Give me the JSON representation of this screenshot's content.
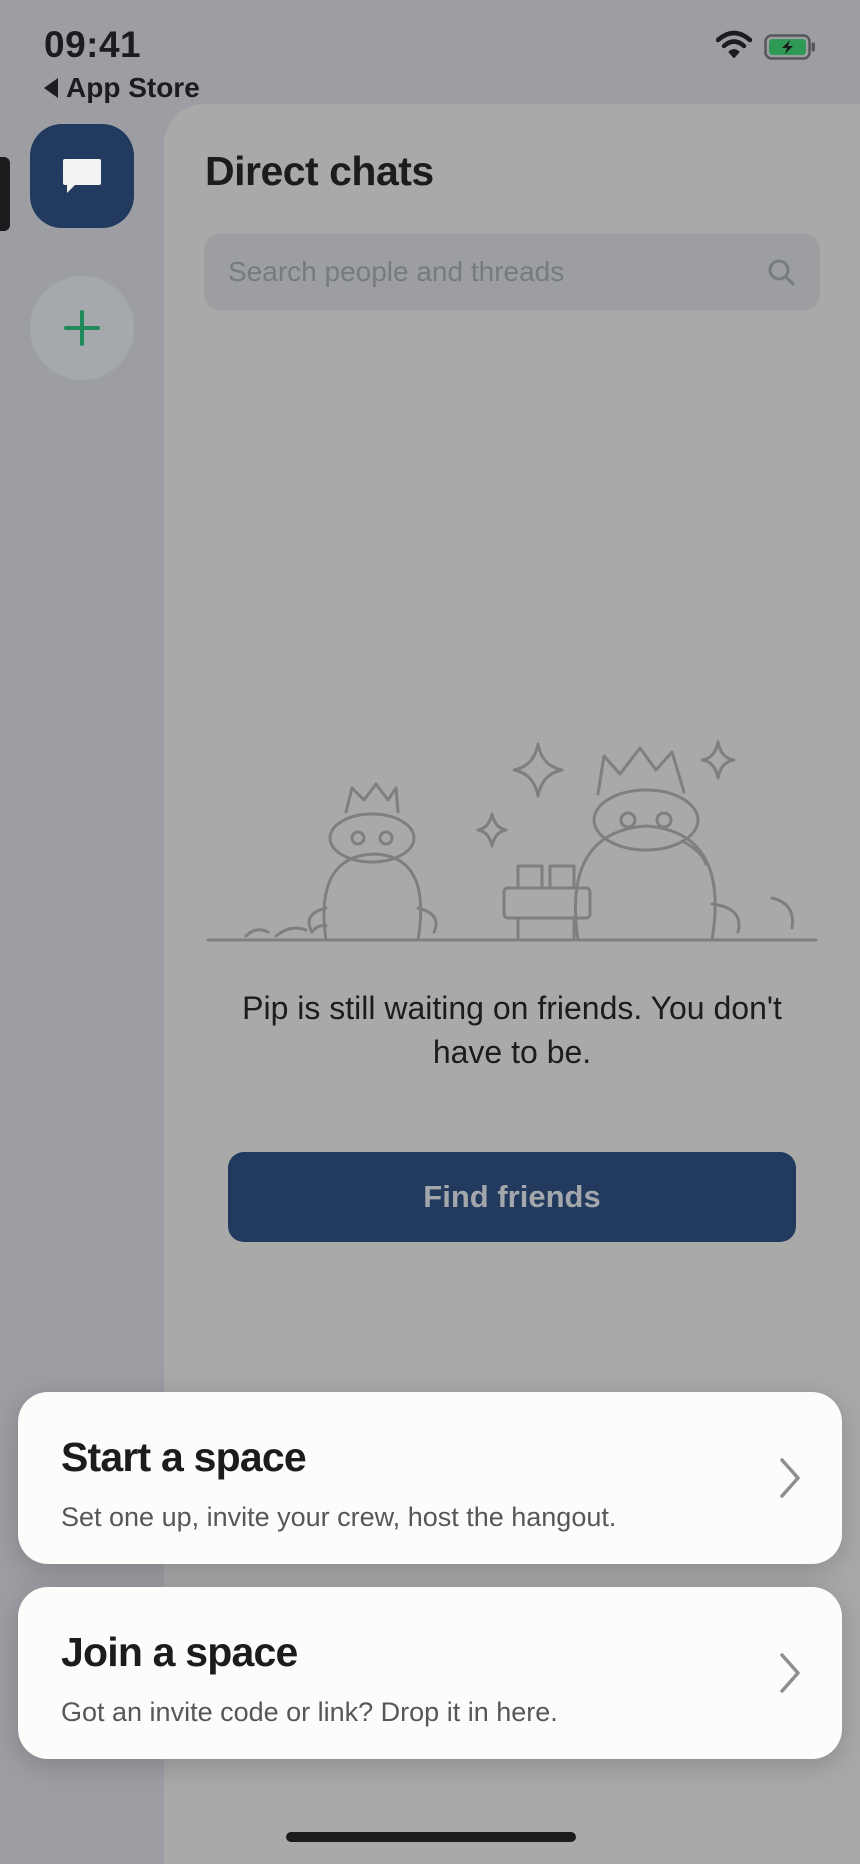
{
  "status_bar": {
    "time": "09:41",
    "back_label": "App Store",
    "icons": [
      "wifi-icon",
      "battery-charging-icon"
    ]
  },
  "rail": {
    "items": [
      {
        "name": "direct-chats",
        "icon": "chat-bubble-icon",
        "selected": true
      },
      {
        "name": "add-space",
        "icon": "plus-icon"
      }
    ],
    "accent": "#213a5e",
    "plus_color": "#1f8a5a"
  },
  "direct_chats": {
    "title": "Direct chats",
    "search_placeholder": "Search people and threads",
    "empty_message": "Pip is still waiting on friends. You don't have to be.",
    "find_button": "Find friends"
  },
  "sheet": {
    "options": [
      {
        "title": "Start a space",
        "subtitle": "Set one up, invite your crew, host the hangout."
      },
      {
        "title": "Join a space",
        "subtitle": "Got an invite code or link? Drop it in here."
      }
    ]
  }
}
